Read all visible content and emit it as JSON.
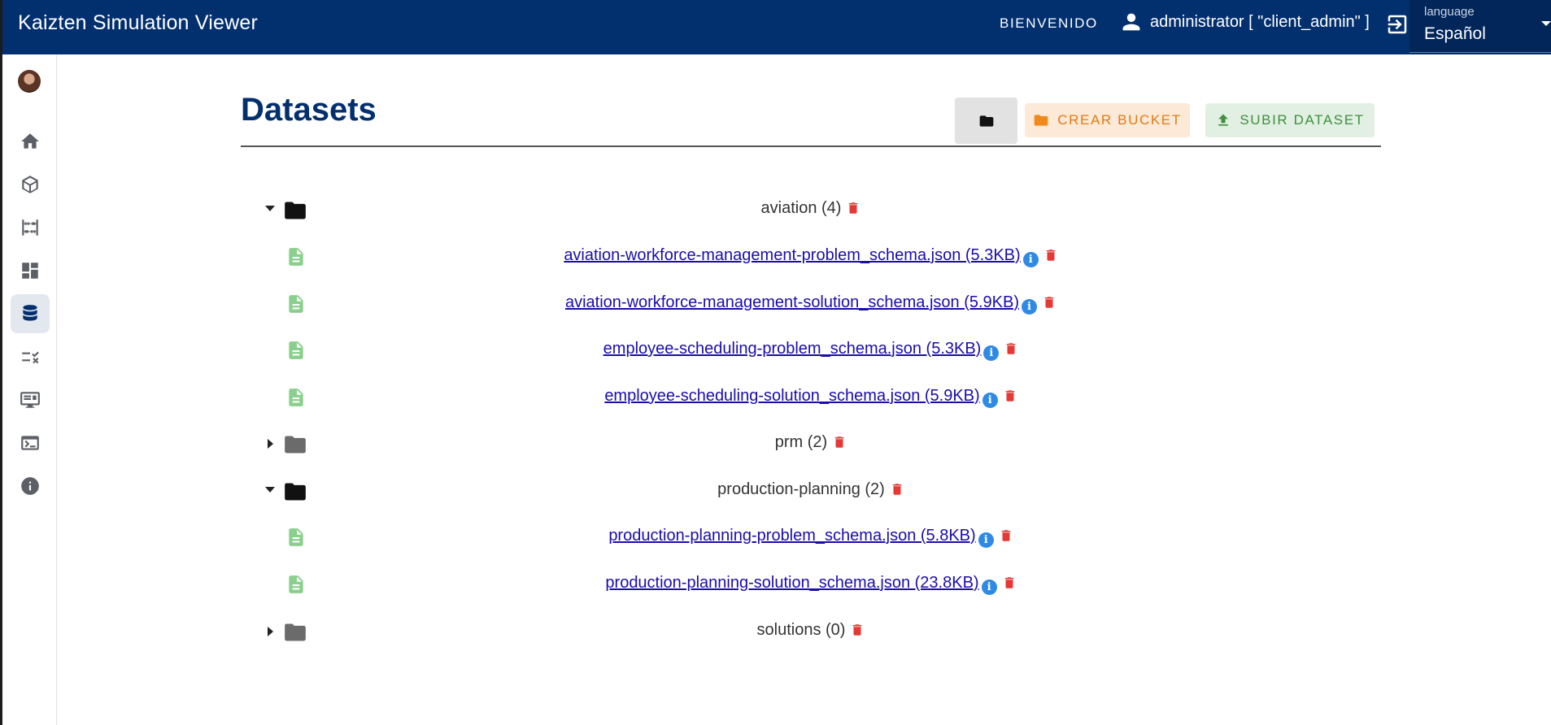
{
  "header": {
    "app_title": "Kaizten Simulation Viewer",
    "welcome": "BIENVENIDO",
    "user": "administrator [ \"client_admin\" ]",
    "language_label": "language",
    "language_value": "Español"
  },
  "sidebar": {
    "items": [
      {
        "name": "home",
        "icon": "home-icon"
      },
      {
        "name": "models",
        "icon": "cube-icon"
      },
      {
        "name": "abacus",
        "icon": "abacus-icon"
      },
      {
        "name": "dashboard",
        "icon": "dashboard-icon"
      },
      {
        "name": "datasets",
        "icon": "database-icon",
        "active": true
      },
      {
        "name": "tasks",
        "icon": "checklist-icon"
      },
      {
        "name": "monitor",
        "icon": "monitor-icon"
      },
      {
        "name": "terminal",
        "icon": "terminal-icon"
      },
      {
        "name": "info",
        "icon": "info-icon"
      }
    ]
  },
  "page": {
    "title": "Datasets",
    "buttons": {
      "create_bucket": "CREAR BUCKET",
      "upload_dataset": "SUBIR DATASET"
    }
  },
  "tree": [
    {
      "type": "folder",
      "label": "aviation (4)",
      "expanded": true
    },
    {
      "type": "file",
      "label": "aviation-workforce-management-problem_schema.json (5.3KB)"
    },
    {
      "type": "file",
      "label": "aviation-workforce-management-solution_schema.json (5.9KB)"
    },
    {
      "type": "file",
      "label": "employee-scheduling-problem_schema.json (5.3KB)"
    },
    {
      "type": "file",
      "label": "employee-scheduling-solution_schema.json (5.9KB)"
    },
    {
      "type": "folder",
      "label": "prm (2)",
      "expanded": false
    },
    {
      "type": "folder",
      "label": "production-planning (2)",
      "expanded": true
    },
    {
      "type": "file",
      "label": "production-planning-problem_schema.json (5.8KB)"
    },
    {
      "type": "file",
      "label": "production-planning-solution_schema.json (23.8KB)"
    },
    {
      "type": "folder",
      "label": "solutions (0)",
      "expanded": false
    }
  ],
  "colors": {
    "primary": "#022f6e",
    "bucket": "#e07b12",
    "upload": "#3e8f3e",
    "delete": "#e53935",
    "info": "#2f8ae6",
    "file_icon": "#8bcf8d"
  }
}
